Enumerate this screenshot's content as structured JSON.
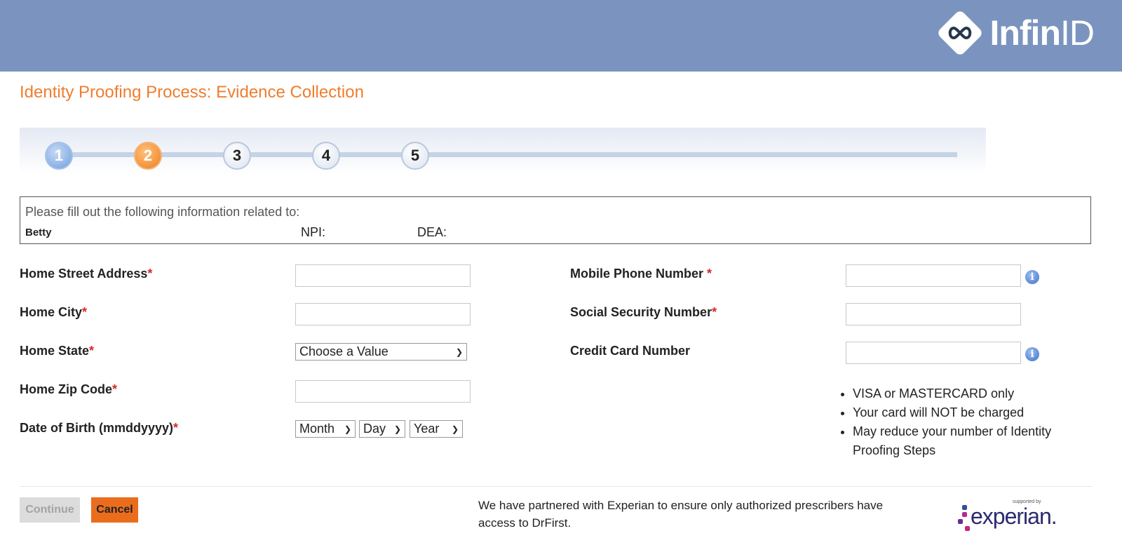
{
  "header": {
    "logo_brand": "Infin",
    "logo_suffix": "ID"
  },
  "page_title": "Identity Proofing Process: Evidence Collection",
  "steps": [
    {
      "label": "1",
      "state": "done"
    },
    {
      "label": "2",
      "state": "current"
    },
    {
      "label": "3",
      "state": "pending"
    },
    {
      "label": "4",
      "state": "pending"
    },
    {
      "label": "5",
      "state": "pending"
    }
  ],
  "info": {
    "prompt": "Please fill out the following information related to:",
    "name": "Betty",
    "npi_label": "NPI:",
    "dea_label": "DEA:"
  },
  "form": {
    "street": {
      "label": "Home Street Address",
      "required_mark": "*",
      "value": ""
    },
    "city": {
      "label": "Home City",
      "required_mark": "*",
      "value": ""
    },
    "state": {
      "label": "Home State",
      "required_mark": "*",
      "selected": "Choose a Value"
    },
    "zip": {
      "label": "Home Zip Code",
      "required_mark": "*",
      "value": ""
    },
    "dob": {
      "label": "Date of Birth (mmddyyyy)",
      "required_mark": "*",
      "month": "Month",
      "day": "Day",
      "year": "Year"
    },
    "mobile": {
      "label": "Mobile Phone Number ",
      "required_mark": "*",
      "value": ""
    },
    "ssn": {
      "label": "Social Security Number",
      "required_mark": "*",
      "value": ""
    },
    "credit_card": {
      "label": "Credit Card Number",
      "value": ""
    }
  },
  "credit_notes": [
    "VISA or MASTERCARD only",
    "Your card will NOT be charged",
    "May reduce your number of Identity Proofing Steps"
  ],
  "buttons": {
    "continue": "Continue",
    "cancel": "Cancel"
  },
  "footer": {
    "partner_text": "We have partnered with Experian to ensure only authorized prescribers have access to DrFirst.",
    "experian_supported": "supported by",
    "experian_word": "experian."
  },
  "colors": {
    "header_bg": "#7b94bf",
    "title_orange": "#ef7d2e",
    "cancel_bg": "#ea6d1e",
    "required_red": "#d42a2a"
  }
}
